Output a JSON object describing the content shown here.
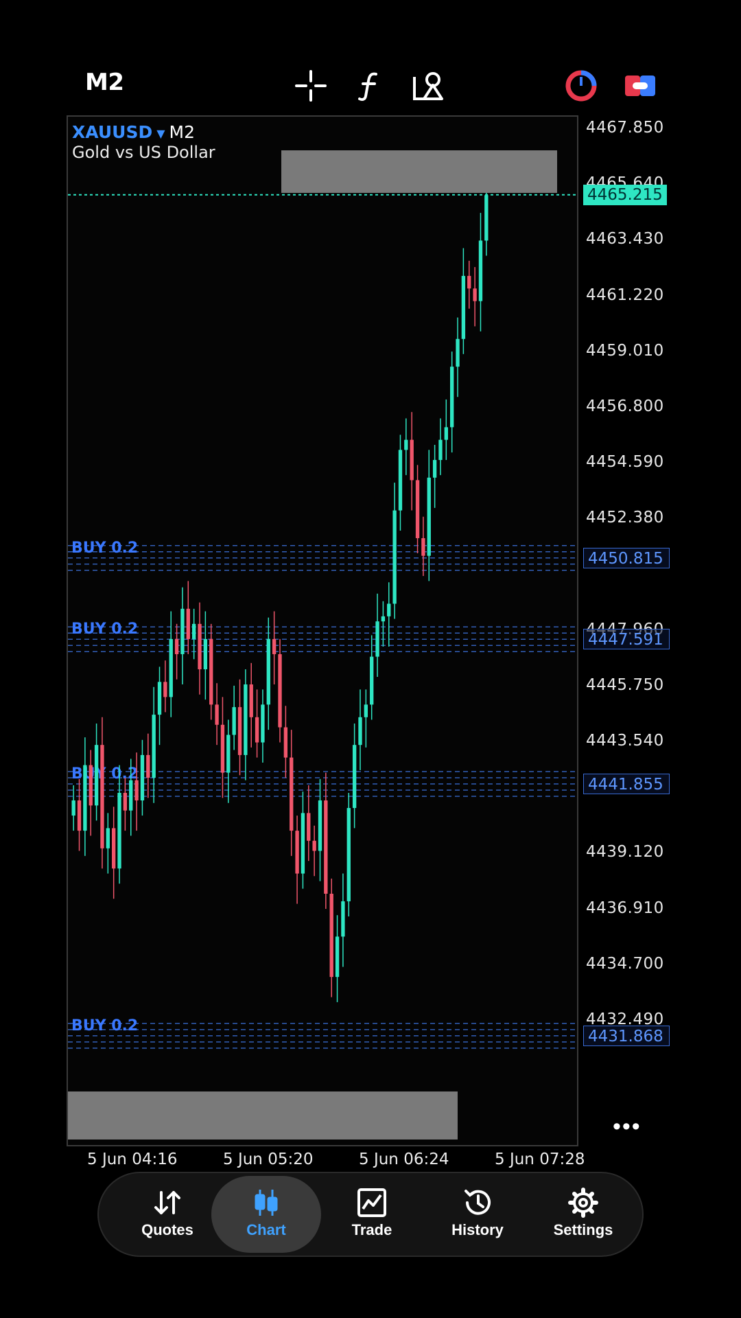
{
  "header": {
    "timeframe": "M2",
    "tools": [
      "crosshair-icon",
      "function-icon",
      "objects-icon",
      "one-click-trading-icon",
      "account-toggle-icon"
    ]
  },
  "chart": {
    "symbol": "XAUUSD",
    "timeframe": "M2",
    "description": "Gold vs US Dollar",
    "current_price": "4465.215",
    "price_ticks": [
      "4467.850",
      "4465.640",
      "4463.430",
      "4461.220",
      "4459.010",
      "4456.800",
      "4454.590",
      "4452.380",
      "4447.960",
      "4445.750",
      "4443.540",
      "4439.120",
      "4436.910",
      "4434.700",
      "4432.490"
    ],
    "time_ticks": [
      "5 Jun 04:16",
      "5 Jun 05:20",
      "5 Jun 06:24",
      "5 Jun 07:28"
    ],
    "orders": [
      {
        "label": "BUY 0.2",
        "price": "4450.815"
      },
      {
        "label": "BUY 0.2",
        "price": "4447.591"
      },
      {
        "label": "BUY 0.2",
        "price": "4441.855"
      },
      {
        "label": "BUY 0.2",
        "price": "4431.868"
      }
    ],
    "colors": {
      "bull": "#2ee6c3",
      "bear": "#f0566b",
      "order": "#3a6fd8",
      "bid_line": "#2ee6c3"
    }
  },
  "chart_data": {
    "type": "candlestick",
    "y_range": [
      4429.5,
      4469.0
    ],
    "candles_close": [
      4441.2,
      4440.0,
      4442.6,
      4441.0,
      4443.4,
      4439.3,
      4440.1,
      4438.5,
      4441.5,
      4440.8,
      4442.0,
      4441.2,
      4443.0,
      4442.1,
      4444.6,
      4445.9,
      4445.3,
      4447.6,
      4447.0,
      4448.8,
      4447.6,
      4448.2,
      4446.4,
      4447.6,
      4445.0,
      4444.2,
      4442.3,
      4443.8,
      4444.9,
      4443.0,
      4445.8,
      4444.5,
      4443.5,
      4445.0,
      4447.6,
      4447.0,
      4444.1,
      4442.9,
      4440.0,
      4438.3,
      4440.7,
      4439.6,
      4439.2,
      4441.2,
      4437.5,
      4434.2,
      4435.8,
      4437.2,
      4440.9,
      4443.4,
      4444.5,
      4445.0,
      4446.9,
      4448.3,
      4448.5,
      4449.0,
      4452.7,
      4455.1,
      4455.5,
      4453.9,
      4451.6,
      4450.9,
      4454.0,
      4454.7,
      4455.5,
      4456.0,
      4458.4,
      4459.5,
      4462.0,
      4461.5,
      4461.0,
      4463.4,
      4465.2
    ],
    "order_levels": [
      4450.815,
      4447.591,
      4441.855,
      4431.868
    ]
  },
  "time_axis": {
    "more": "•••"
  },
  "nav": {
    "items": [
      {
        "label": "Quotes",
        "icon": "quotes-icon"
      },
      {
        "label": "Chart",
        "icon": "chart-icon"
      },
      {
        "label": "Trade",
        "icon": "trade-icon"
      },
      {
        "label": "History",
        "icon": "history-icon"
      },
      {
        "label": "Settings",
        "icon": "settings-icon"
      }
    ],
    "active": "Chart"
  }
}
